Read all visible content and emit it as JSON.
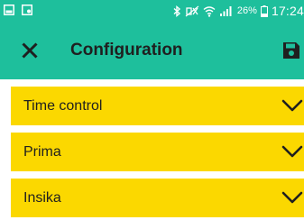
{
  "status_bar": {
    "left_icons": [
      "gallery-icon",
      "screenshot-icon"
    ],
    "right_icons": [
      "bluetooth-icon",
      "mute-icon",
      "wifi-icon",
      "signal-icon",
      "battery-icon"
    ],
    "battery_percent": "26%",
    "time": "17:24",
    "color": "#1ebf9c"
  },
  "app_bar": {
    "title": "Configuration",
    "close_icon": "close-icon",
    "save_icon": "save-icon",
    "color": "#1ebf9c"
  },
  "sections": [
    {
      "label": "Time control",
      "icon": "chevron-down-icon"
    },
    {
      "label": "Prima",
      "icon": "chevron-down-icon"
    },
    {
      "label": "Insika",
      "icon": "chevron-down-icon"
    }
  ],
  "colors": {
    "section_background": "#fbd800",
    "text": "#1f1f1f"
  }
}
